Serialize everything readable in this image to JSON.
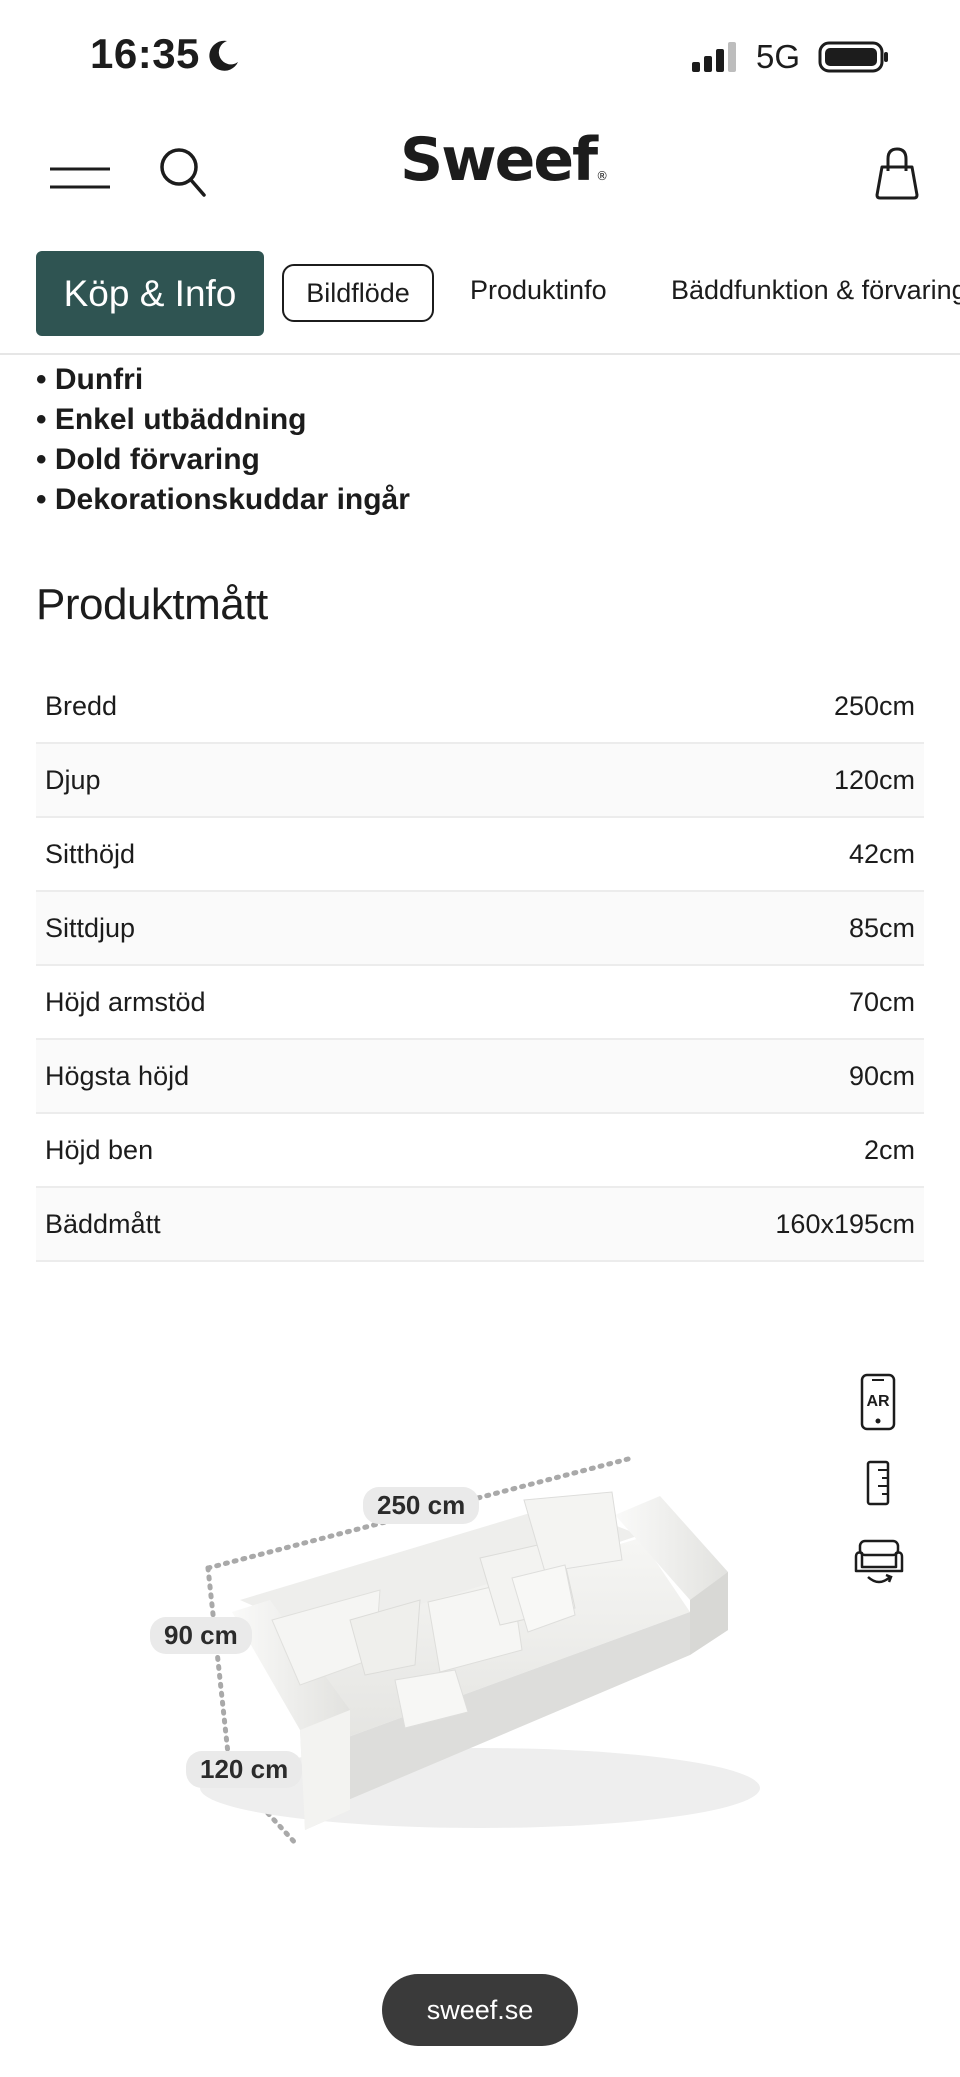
{
  "status_bar": {
    "time": "16:35",
    "network": "5G",
    "icons": [
      "moon-icon",
      "signal-icon",
      "battery-icon"
    ]
  },
  "header": {
    "logo": "Sweef",
    "logo_mark": "®",
    "icons": [
      "menu-icon",
      "search-icon",
      "bag-icon"
    ]
  },
  "tabs": [
    {
      "label": "Köp & Info"
    },
    {
      "label": "Bildflöde"
    },
    {
      "label": "Produktinfo"
    },
    {
      "label": "Bäddfunktion & förvaring"
    }
  ],
  "features": [
    "• Dunfri",
    "• Enkel utbäddning",
    "• Dold förvaring",
    "• Dekorationskuddar ingår"
  ],
  "dimensions": {
    "title": "Produktmått",
    "rows": [
      {
        "label": "Bredd",
        "value": "250cm"
      },
      {
        "label": "Djup",
        "value": "120cm"
      },
      {
        "label": "Sitthöjd",
        "value": "42cm"
      },
      {
        "label": "Sittdjup",
        "value": "85cm"
      },
      {
        "label": "Höjd armstöd",
        "value": "70cm"
      },
      {
        "label": "Högsta höjd",
        "value": "90cm"
      },
      {
        "label": "Höjd ben",
        "value": "2cm"
      },
      {
        "label": "Bäddmått",
        "value": "160x195cm"
      }
    ]
  },
  "viewer": {
    "labels": {
      "width": "250 cm",
      "height": "90 cm",
      "depth": "120 cm"
    },
    "ar_label": "AR",
    "icons": [
      "ar-icon",
      "ruler-icon",
      "sofa-swap-icon"
    ]
  },
  "footer": {
    "url": "sweef.se"
  },
  "colors": {
    "accent": "#2f5452",
    "pill": "#3a3a3a"
  }
}
